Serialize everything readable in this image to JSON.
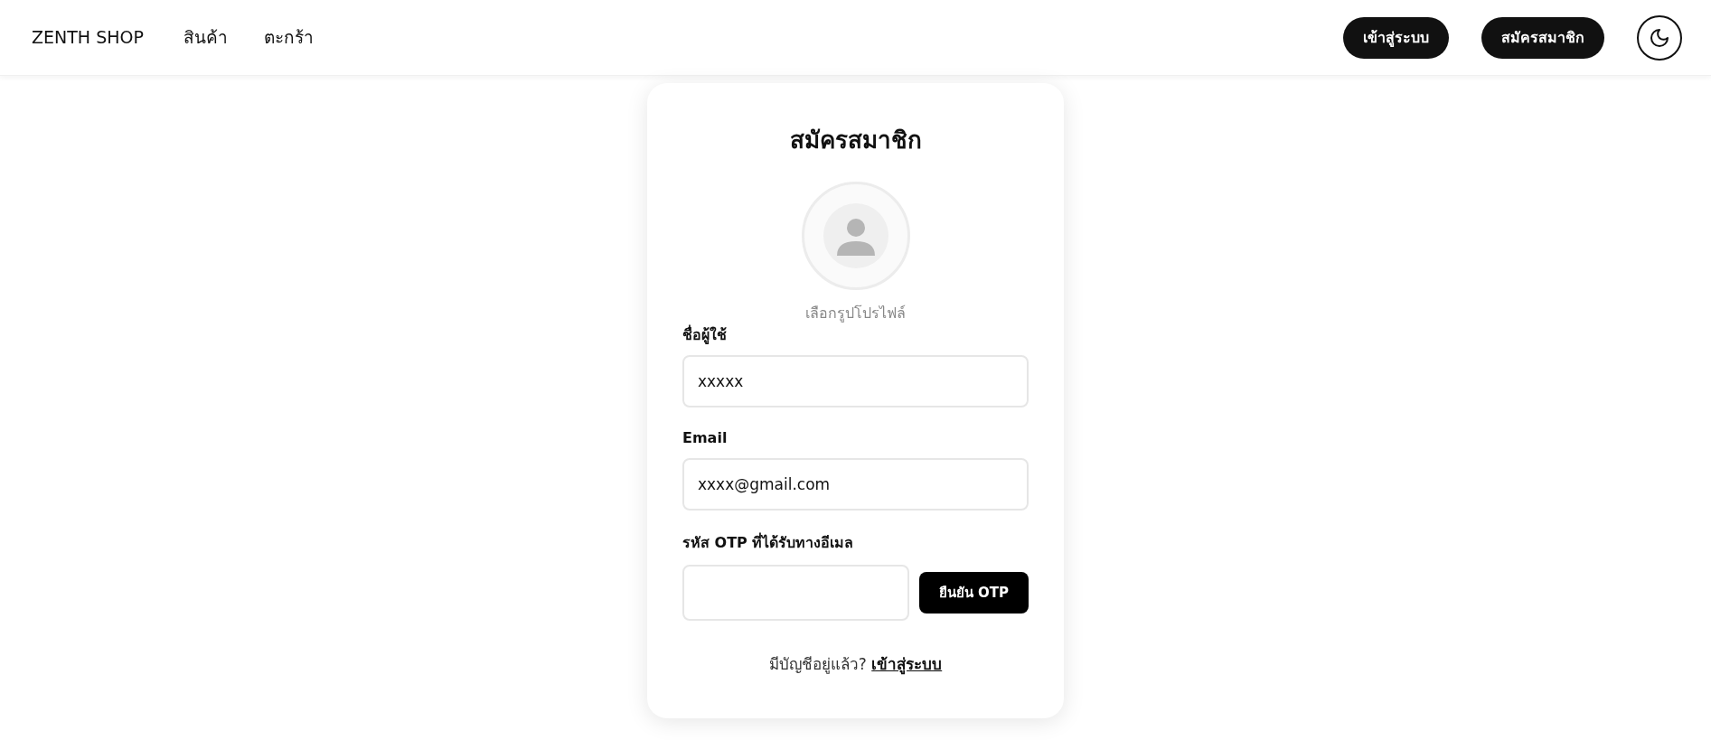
{
  "navbar": {
    "brand": "ZENTH SHOP",
    "links": [
      "สินค้า",
      "ตะกร้า"
    ],
    "buttons": [
      "เข้าสู่ระบบ",
      "สมัครสมาชิก"
    ]
  },
  "form": {
    "title": "สมัครสมาชิก",
    "avatar_caption": "เลือกรูปโปรไฟล์",
    "fields": [
      {
        "label": "ชื่อผู้ใช้",
        "value": "xxxxx"
      },
      {
        "label": "Email",
        "value": "xxxx@gmail.com"
      }
    ],
    "otp": {
      "label": "รหัส OTP ที่ได้รับทางอีเมล",
      "button": "ยืนยัน OTP"
    },
    "footer": {
      "text": "มีบัญชีอยู่แล้ว?",
      "link": "เข้าสู่ระบบ"
    }
  }
}
